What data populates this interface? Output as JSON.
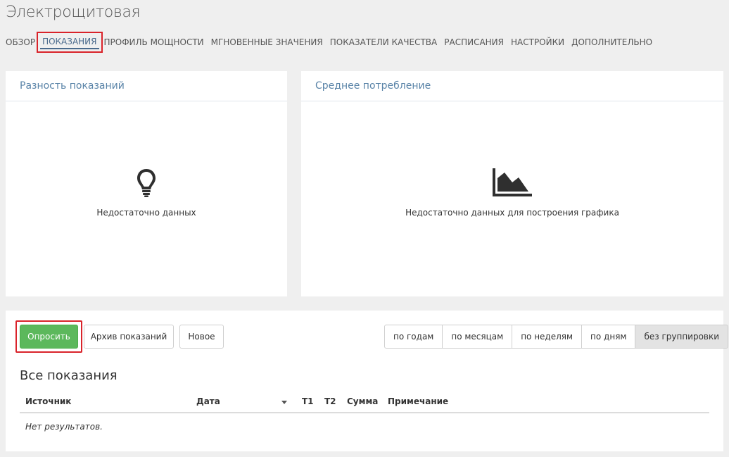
{
  "page": {
    "title": "Электрощитовая"
  },
  "tabs": [
    {
      "label": "ОБЗОР",
      "active": false
    },
    {
      "label": "ПОКАЗАНИЯ",
      "active": true
    },
    {
      "label": "ПРОФИЛЬ МОЩНОСТИ",
      "active": false
    },
    {
      "label": "МГНОВЕННЫЕ ЗНАЧЕНИЯ",
      "active": false
    },
    {
      "label": "ПОКАЗАТЕЛИ КАЧЕСТВА",
      "active": false
    },
    {
      "label": "РАСПИСАНИЯ",
      "active": false
    },
    {
      "label": "НАСТРОЙКИ",
      "active": false
    },
    {
      "label": "ДОПОЛНИТЕЛЬНО",
      "active": false
    }
  ],
  "panels": {
    "difference": {
      "title": "Разность показаний",
      "icon": "lightbulb-icon",
      "empty_text": "Недостаточно данных"
    },
    "consumption": {
      "title": "Среднее потребление",
      "icon": "area-chart-icon",
      "empty_text": "Недостаточно данных для построения графика"
    }
  },
  "toolbar": {
    "poll_label": "Опросить",
    "archive_label": "Архив показаний",
    "new_label": "Новое",
    "primary_color": "#5cb85c"
  },
  "grouping": {
    "options": [
      "по годам",
      "по месяцам",
      "по неделям",
      "по дням",
      "без группировки"
    ],
    "selected": "без группировки"
  },
  "readings": {
    "title": "Все показания",
    "columns": [
      "Источник",
      "Дата",
      "T1",
      "T2",
      "Сумма",
      "Примечание"
    ],
    "sort_column": "Дата",
    "empty_text": "Нет результатов."
  }
}
